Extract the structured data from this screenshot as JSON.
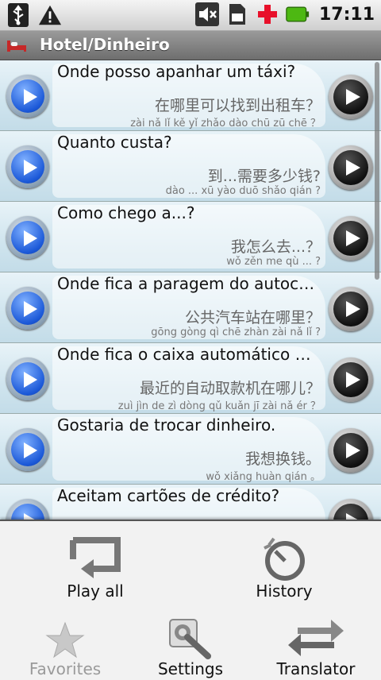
{
  "status_bar": {
    "time": "17:11",
    "icons": [
      "usb-icon",
      "warning-icon",
      "mute-icon",
      "sd-card-icon",
      "plus-icon",
      "battery-icon"
    ]
  },
  "title_bar": {
    "title": "Hotel/Dinheiro",
    "icon": "bed-icon"
  },
  "phrases": [
    {
      "pt": "Onde posso apanhar um táxi?",
      "zh": "在哪里可以找到出租车？",
      "pinyin": "zài nǎ lǐ kě yǐ zhǎo dào chū zū chē ？"
    },
    {
      "pt": "Quanto custa?",
      "zh": "到...需要多少钱?",
      "pinyin": "dào ... xū yào duō shǎo qián ?"
    },
    {
      "pt": "Como chego a...?",
      "zh": "我怎么去...？",
      "pinyin": "wǒ zěn me qù ... ?"
    },
    {
      "pt": "Onde fica a paragem do autocarro?",
      "zh": "公共汽车站在哪里？",
      "pinyin": "gōng gòng qì chē zhàn zài nǎ lǐ ?"
    },
    {
      "pt": "Onde fica o caixa automático mais...",
      "zh": "最近的自动取款机在哪儿？",
      "pinyin": "zuì jìn de zì dòng qǔ kuǎn jī zài nǎ ér ？"
    },
    {
      "pt": "Gostaria de trocar dinheiro.",
      "zh": "我想换钱。",
      "pinyin": "wǒ xiǎng huàn qián 。"
    },
    {
      "pt": "Aceitam cartões de crédito?",
      "zh": "",
      "pinyin": ""
    }
  ],
  "menu": {
    "play_all": "Play all",
    "history": "History",
    "favorites": "Favorites",
    "settings": "Settings",
    "translator": "Translator"
  }
}
